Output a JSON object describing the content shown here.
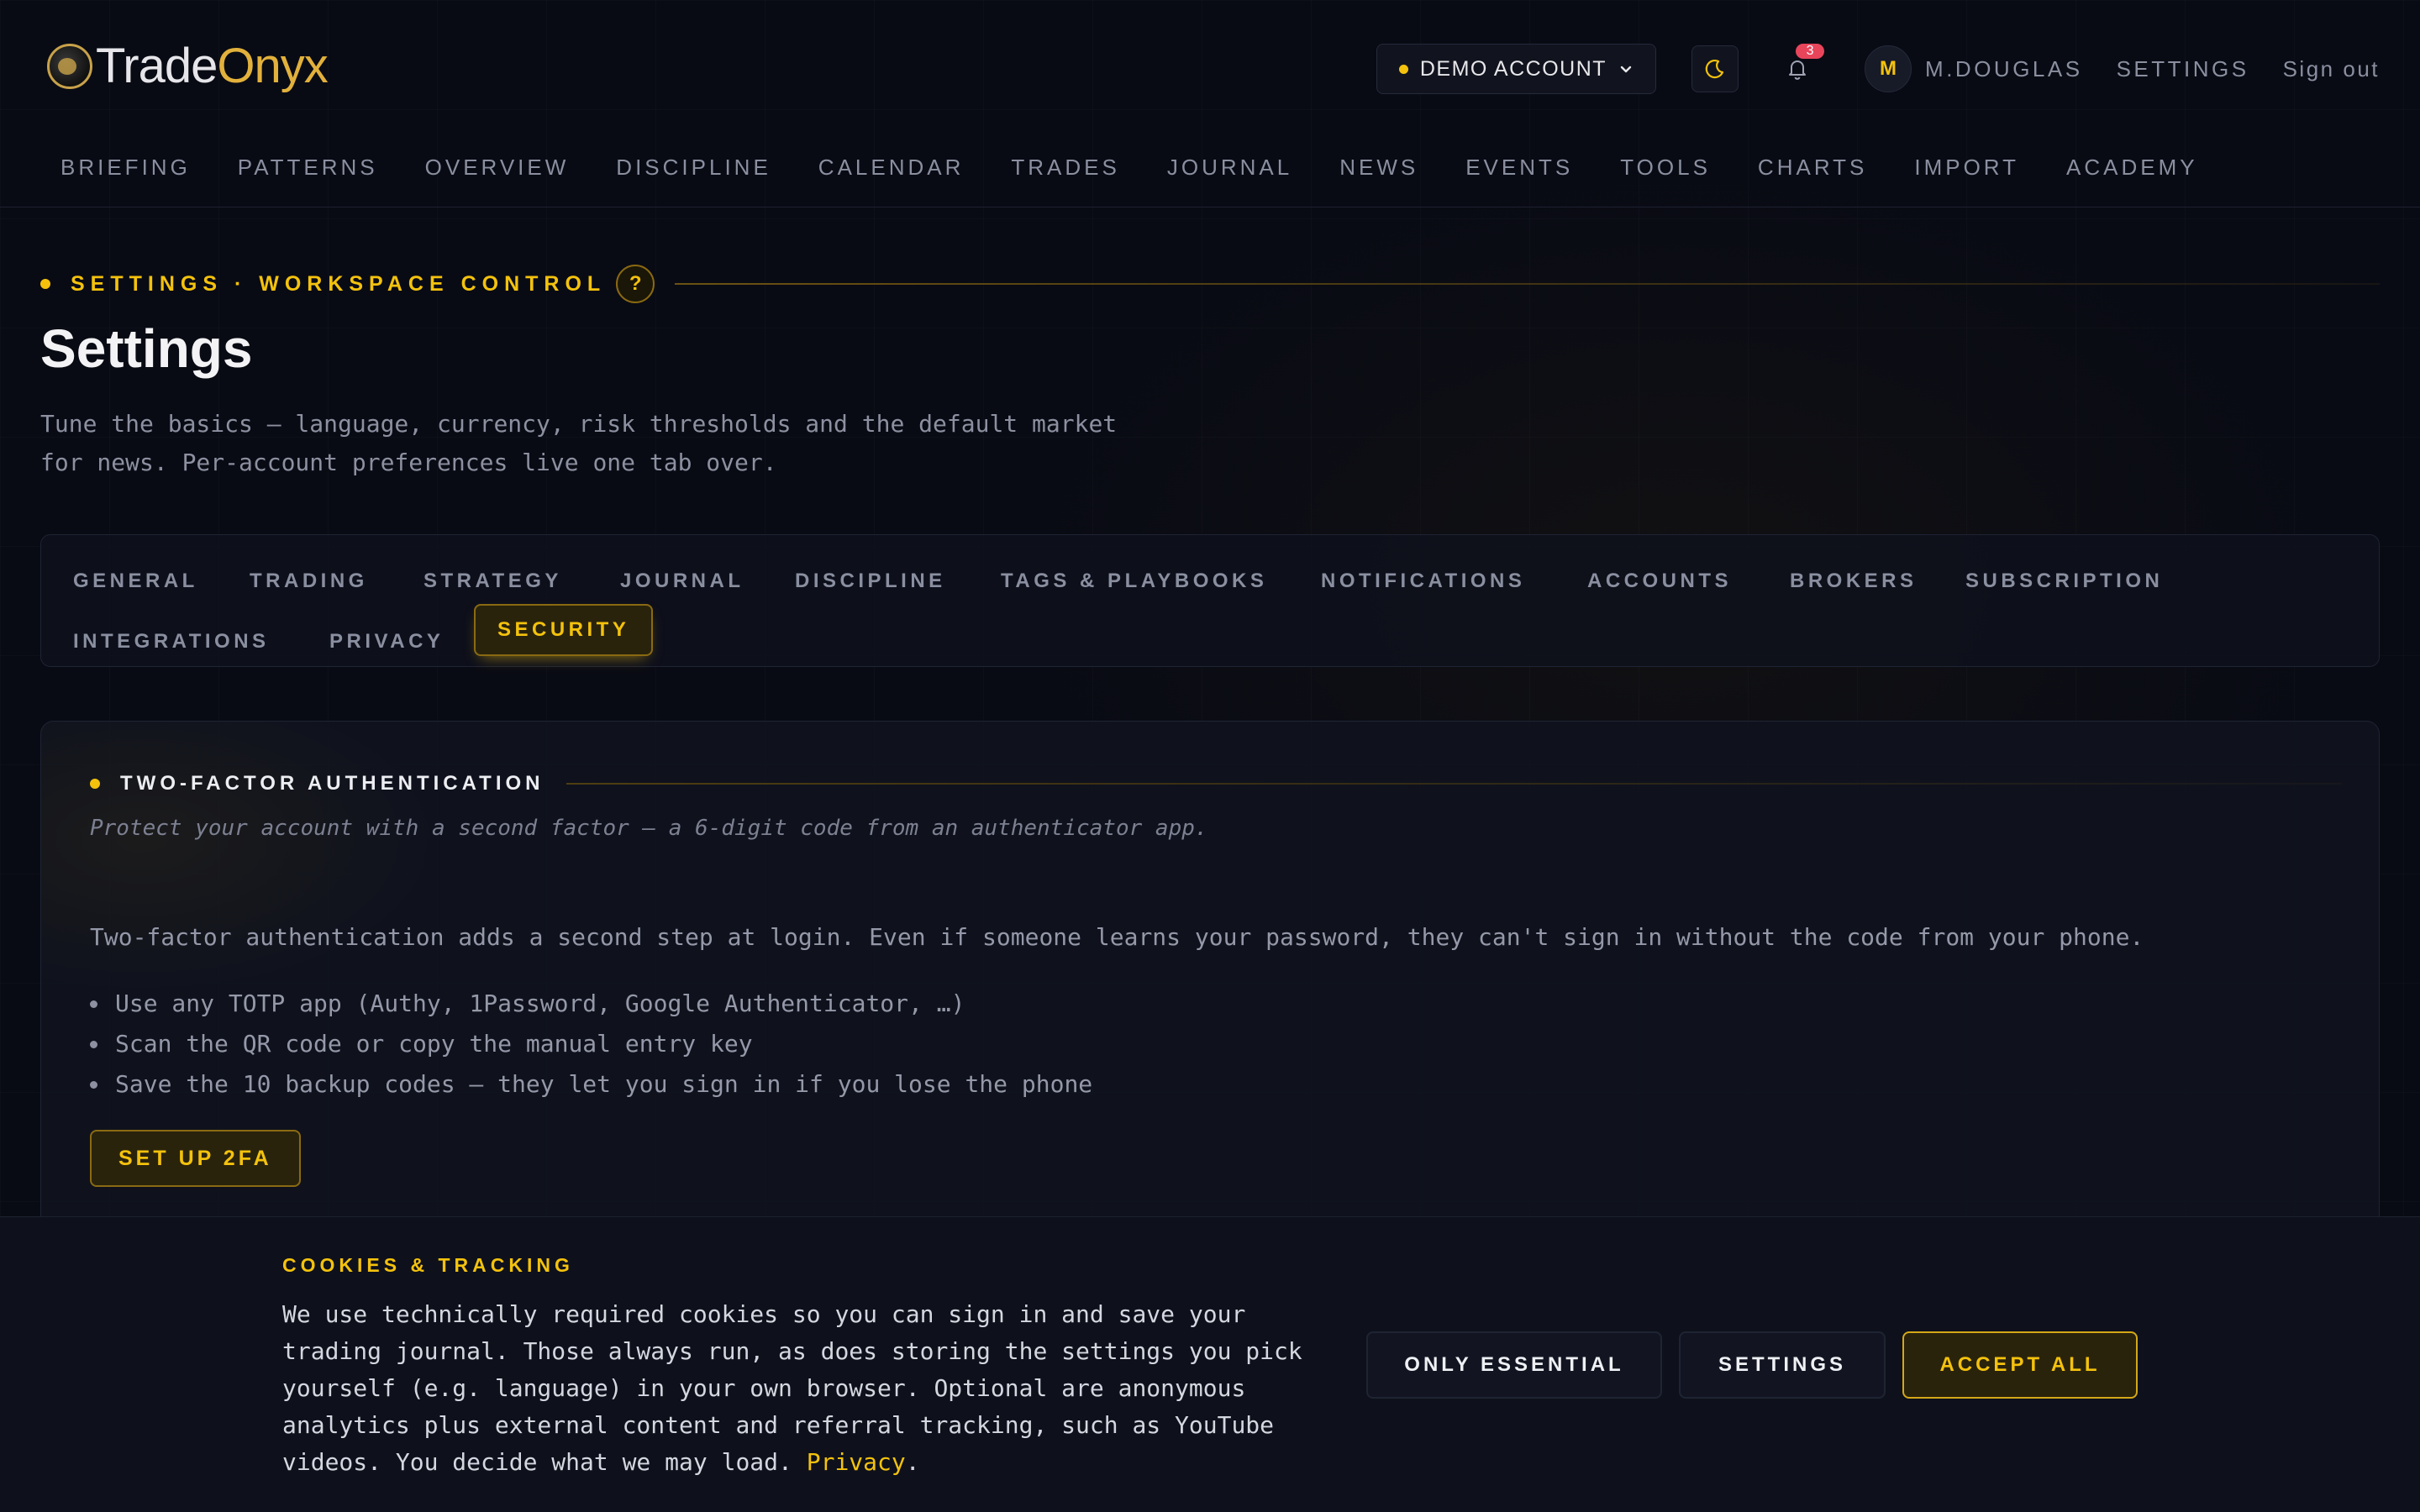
{
  "brand": {
    "part1": "Trade",
    "part2": "Onyx"
  },
  "header": {
    "account_label": "DEMO ACCOUNT",
    "notifications_count": "3",
    "avatar_initial": "M",
    "user_name": "M.DOUGLAS",
    "settings_link": "SETTINGS",
    "signout_link": "Sign out"
  },
  "nav": [
    "BRIEFING",
    "PATTERNS",
    "OVERVIEW",
    "DISCIPLINE",
    "CALENDAR",
    "TRADES",
    "JOURNAL",
    "NEWS",
    "EVENTS",
    "TOOLS",
    "CHARTS",
    "IMPORT",
    "ACADEMY"
  ],
  "page": {
    "eyebrow": "SETTINGS · WORKSPACE CONTROL",
    "help": "?",
    "title": "Settings",
    "subtitle": "Tune the basics — language, currency, risk thresholds and the default market for news. Per-account preferences live one tab over."
  },
  "tabs": {
    "general": "GENERAL",
    "trading": "TRADING",
    "strategy": "STRATEGY",
    "journal": "JOURNAL",
    "discipline": "DISCIPLINE",
    "tags": "TAGS & PLAYBOOKS",
    "notifications": "NOTIFICATIONS",
    "accounts": "ACCOUNTS",
    "brokers": "BROKERS",
    "subscription": "SUBSCRIPTION",
    "integrations": "INTEGRATIONS",
    "privacy": "PRIVACY",
    "security": "SECURITY",
    "active": "SECURITY"
  },
  "twofa": {
    "title": "TWO-FACTOR AUTHENTICATION",
    "description": "Protect your account with a second factor — a 6-digit code from an authenticator app.",
    "body": "Two-factor authentication adds a second step at login. Even if someone learns your password, they can't sign in without the code from your phone.",
    "bullets": [
      "Use any TOTP app (Authy, 1Password, Google Authenticator, …)",
      "Scan the QR code or copy the manual entry key",
      "Save the 10 backup codes — they let you sign in if you lose the phone"
    ],
    "button": "SET UP 2FA"
  },
  "cookies": {
    "title": "COOKIES & TRACKING",
    "text": "We use technically required cookies so you can sign in and save your trading journal. Those always run, as does storing the settings you pick yourself (e.g. language) in your own browser. Optional are anonymous analytics plus external content and referral tracking, such as YouTube videos. You decide what we may load.",
    "privacy_link": "Privacy",
    "only_essential": "ONLY ESSENTIAL",
    "settings": "SETTINGS",
    "accept_all": "ACCEPT ALL"
  },
  "colors": {
    "accent": "#f4c20d",
    "background": "#090b14",
    "badge": "#e8455b"
  },
  "icons": {
    "theme": "moon-icon",
    "notifications": "bell-icon",
    "account_dropdown": "chevron-down-icon"
  }
}
